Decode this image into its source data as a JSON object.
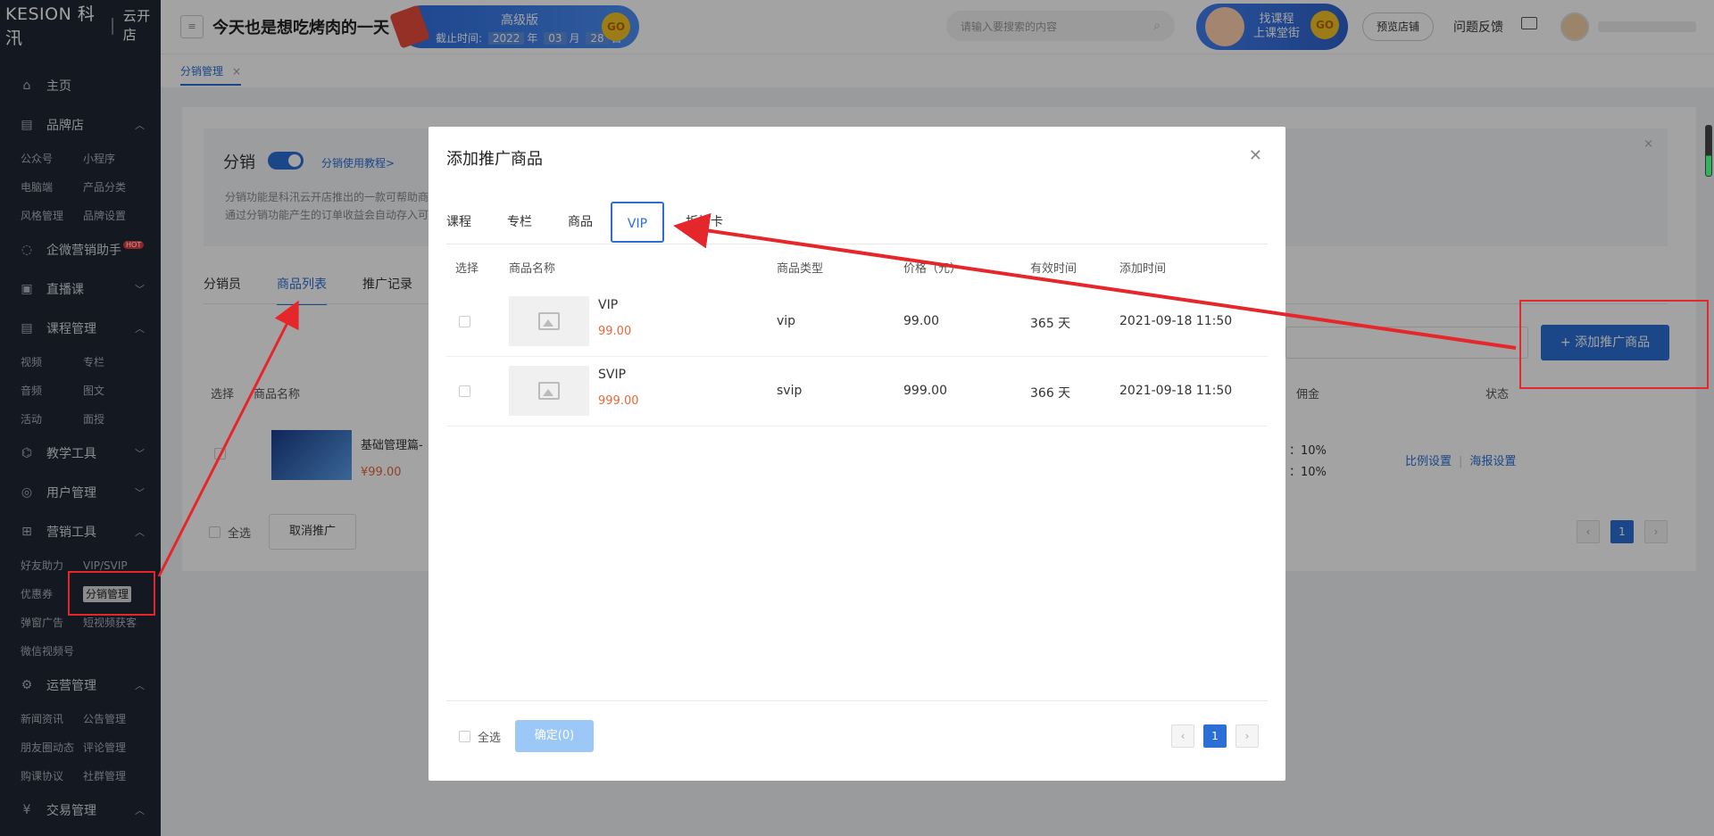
{
  "sidebar": {
    "logo": "KESION 科汛",
    "logo_sub": "云开店",
    "home": "主页",
    "brand": {
      "label": "品牌店",
      "items": [
        "公众号",
        "小程序",
        "电脑端",
        "产品分类",
        "风格管理",
        "品牌设置"
      ]
    },
    "wecom": "企微营销助手",
    "hot": "HOT",
    "live": "直播课",
    "course": {
      "label": "课程管理",
      "items": [
        "视频",
        "专栏",
        "音频",
        "图文",
        "活动",
        "面授"
      ]
    },
    "teach": "教学工具",
    "users": "用户管理",
    "marketing": {
      "label": "营销工具",
      "items": [
        "好友助力",
        "VIP/SVIP",
        "优惠券",
        "分销管理",
        "弹窗广告",
        "短视频获客",
        "微信视频号"
      ]
    },
    "ops": {
      "label": "运营管理",
      "items": [
        "新闻资讯",
        "公告管理",
        "朋友圈动态",
        "评论管理",
        "购课协议",
        "社群管理"
      ]
    },
    "trade": "交易管理"
  },
  "header": {
    "shop_name": "今天也是想吃烤肉的一天",
    "edition": "高级版",
    "expire_label": "截止时间:",
    "expire_year": "2022",
    "expire_month": "03",
    "expire_day": "28",
    "year_unit": "年",
    "month_unit": "月",
    "day_unit": "日",
    "go": "GO",
    "search_placeholder": "请输入要搜索的内容",
    "promo_line1": "找课程",
    "promo_line2": "上课堂街",
    "preview": "预览店铺",
    "feedback": "问题反馈"
  },
  "tabstrip": {
    "tab": "分销管理"
  },
  "panel": {
    "title": "分销",
    "tutorial": "分销使用教程>",
    "desc1": "分销功能是科汛云开店推出的一款可帮助商",
    "desc2": "通过分销功能产生的订单收益会自动存入可",
    "tabs": [
      "分销员",
      "商品列表",
      "推广记录"
    ],
    "add_button": "+ 添加推广商品",
    "col_select": "选择",
    "col_name": "商品名称",
    "col_commission": "佣金",
    "col_status": "状态",
    "row_name": "基础管理篇-",
    "row_price": "¥99.00",
    "row_commission_1": "：10%",
    "row_commission_2": "：10%",
    "op_ratio": "比例设置",
    "op_poster": "海报设置",
    "select_all": "全选",
    "cancel_promo": "取消推广",
    "page": "1"
  },
  "modal": {
    "title": "添加推广商品",
    "tabs": [
      "课程",
      "专栏",
      "商品",
      "VIP",
      "折扣卡"
    ],
    "active_tab": "VIP",
    "columns": [
      "选择",
      "商品名称",
      "商品类型",
      "价格（元）",
      "有效时间",
      "添加时间"
    ],
    "rows": [
      {
        "name": "VIP",
        "price": "99.00",
        "type": "vip",
        "price_col": "99.00",
        "valid": "365 天",
        "added": "2021-09-18 11:50"
      },
      {
        "name": "SVIP",
        "price": "999.00",
        "type": "svip",
        "price_col": "999.00",
        "valid": "366 天",
        "added": "2021-09-18 11:50"
      }
    ],
    "select_all": "全选",
    "confirm": "确定(0)",
    "page": "1"
  },
  "colors": {
    "primary": "#2b6fd6",
    "price": "#e8673a",
    "annotation": "#e5262b",
    "sidebar": "#1f2634"
  }
}
